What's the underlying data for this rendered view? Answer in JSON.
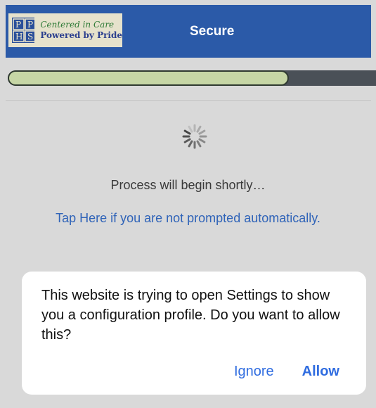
{
  "header": {
    "title": "Secure",
    "logo": {
      "line1": "Centered in Care",
      "line2": "Powered by Pride",
      "mark_text": "PPHS"
    }
  },
  "progress": {
    "fraction": 0.74,
    "fill_color": "#c6d6a5",
    "track_color": "#4a5057"
  },
  "main": {
    "status_text": "Process will begin shortly…",
    "tap_link": "Tap Here if you are not prompted automatically."
  },
  "dialog": {
    "message": "This website is trying to open Settings to show you a configuration profile. Do you want to allow this?",
    "ignore_label": "Ignore",
    "allow_label": "Allow"
  },
  "colors": {
    "header_bg": "#2b5aa8",
    "link": "#2f63b8",
    "button": "#2f6ce0"
  },
  "icons": {
    "spinner": "loading-spinner-icon"
  }
}
